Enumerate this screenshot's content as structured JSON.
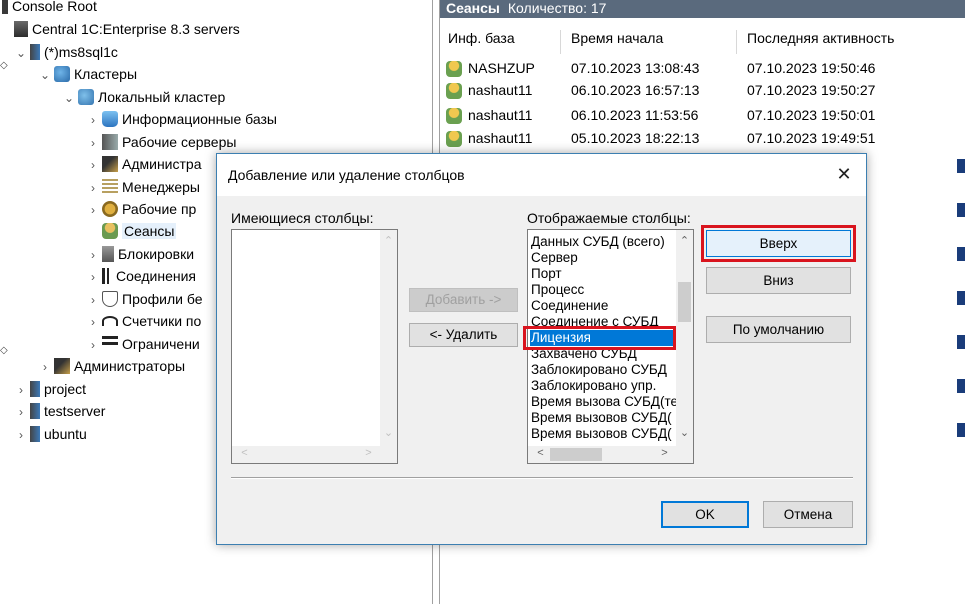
{
  "tree": {
    "console_root": "Console Root",
    "servers": "Central 1C:Enterprise 8.3 servers",
    "host": "(*)ms8sql1c",
    "clusters": "Кластеры",
    "local_cluster": "Локальный кластер",
    "items": [
      "Информационные базы",
      "Рабочие серверы",
      "Администра",
      "Менеджеры",
      "Рабочие пр",
      "Сеансы",
      "Блокировки",
      "Соединения",
      "Профили бе",
      "Счетчики по",
      "Ограничени"
    ],
    "admins": "Администраторы",
    "other_hosts": [
      "project",
      "testserver",
      "ubuntu"
    ]
  },
  "sessions": {
    "title": "Сеансы",
    "count_label": "Количество: 17",
    "columns": [
      "Инф. база",
      "Время начала",
      "Последняя активность"
    ],
    "rows": [
      {
        "ib": "NASHZUP",
        "start": "07.10.2023 13:08:43",
        "last": "07.10.2023 19:50:46"
      },
      {
        "ib": "nashaut11",
        "start": "06.10.2023 16:57:13",
        "last": "07.10.2023 19:50:27"
      },
      {
        "ib": "nashaut11",
        "start": "06.10.2023 11:53:56",
        "last": "07.10.2023 19:50:01"
      },
      {
        "ib": "nashaut11",
        "start": "05.10.2023 18:22:13",
        "last": "07.10.2023 19:49:51"
      }
    ]
  },
  "dialog": {
    "title": "Добавление или удаление столбцов",
    "available_label": "Имеющиеся столбцы:",
    "displayed_label": "Отображаемые столбцы:",
    "displayed_items": [
      "Данных СУБД (всего)",
      "Сервер",
      "Порт",
      "Процесс",
      "Соединение",
      "Соединение с СУБД",
      "Лицензия",
      "Захвачено СУБД",
      "Заблокировано СУБД",
      "Заблокировано упр.",
      "Время вызова СУБД(те",
      "Время вызовов СУБД(",
      "Время вызовов СУБД("
    ],
    "selected_item": "Лицензия",
    "buttons": {
      "add": "Добавить ->",
      "remove": "<- Удалить",
      "up": "Вверх",
      "down": "Вниз",
      "default": "По умолчанию",
      "ok": "OK",
      "cancel": "Отмена"
    },
    "highlight_color": "#d9141e",
    "selection_color": "#0078d7"
  }
}
